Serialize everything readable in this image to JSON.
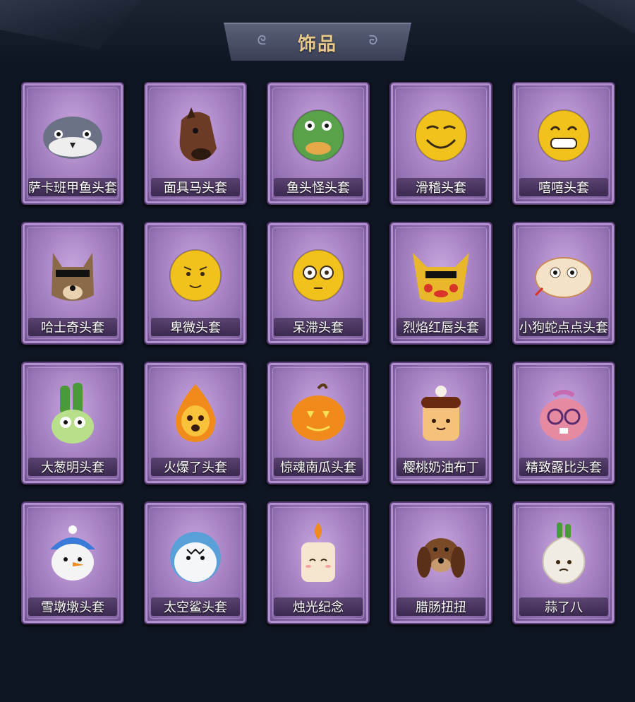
{
  "header": {
    "title": "饰品"
  },
  "items": [
    {
      "label": "萨卡班甲鱼头套",
      "icon": "fish-head-icon",
      "color": "#6b7286"
    },
    {
      "label": "面具马头套",
      "icon": "horse-head-icon",
      "color": "#6b3b26"
    },
    {
      "label": "鱼头怪头套",
      "icon": "fish-monster-icon",
      "color": "#5aa24a"
    },
    {
      "label": "滑稽头套",
      "icon": "funny-face-icon",
      "color": "#f2c21c"
    },
    {
      "label": "嘻嘻头套",
      "icon": "grin-face-icon",
      "color": "#f2c21c"
    },
    {
      "label": "哈士奇头套",
      "icon": "husky-sunglasses-icon",
      "color": "#8a6a48"
    },
    {
      "label": "卑微头套",
      "icon": "humble-face-icon",
      "color": "#f2c21c"
    },
    {
      "label": "呆滞头套",
      "icon": "dazed-face-icon",
      "color": "#f2c21c"
    },
    {
      "label": "烈焰红唇头套",
      "icon": "yellow-mouse-sunglasses-icon",
      "color": "#e8b82a"
    },
    {
      "label": "小狗蛇点点头套",
      "icon": "snake-head-icon",
      "color": "#f3e2c6"
    },
    {
      "label": "大葱明头套",
      "icon": "scallion-head-icon",
      "color": "#6fb84a"
    },
    {
      "label": "火爆了头套",
      "icon": "fire-spirit-icon",
      "color": "#f08a1a"
    },
    {
      "label": "惊魂南瓜头套",
      "icon": "pumpkin-head-icon",
      "color": "#f08a1a"
    },
    {
      "label": "樱桃奶油布丁",
      "icon": "pudding-head-icon",
      "color": "#f4c27a"
    },
    {
      "label": "精致露比头套",
      "icon": "pink-beaver-glasses-icon",
      "color": "#e58aa0"
    },
    {
      "label": "雪墩墩头套",
      "icon": "snowman-head-icon",
      "color": "#f4f4f4"
    },
    {
      "label": "太空鲨头套",
      "icon": "space-shark-icon",
      "color": "#5aa0d8"
    },
    {
      "label": "烛光纪念",
      "icon": "candle-head-icon",
      "color": "#f6e6d0"
    },
    {
      "label": "腊肠扭扭",
      "icon": "dachshund-head-icon",
      "color": "#7a4a28"
    },
    {
      "label": "蒜了八",
      "icon": "garlic-head-icon",
      "color": "#f0ece4"
    }
  ]
}
